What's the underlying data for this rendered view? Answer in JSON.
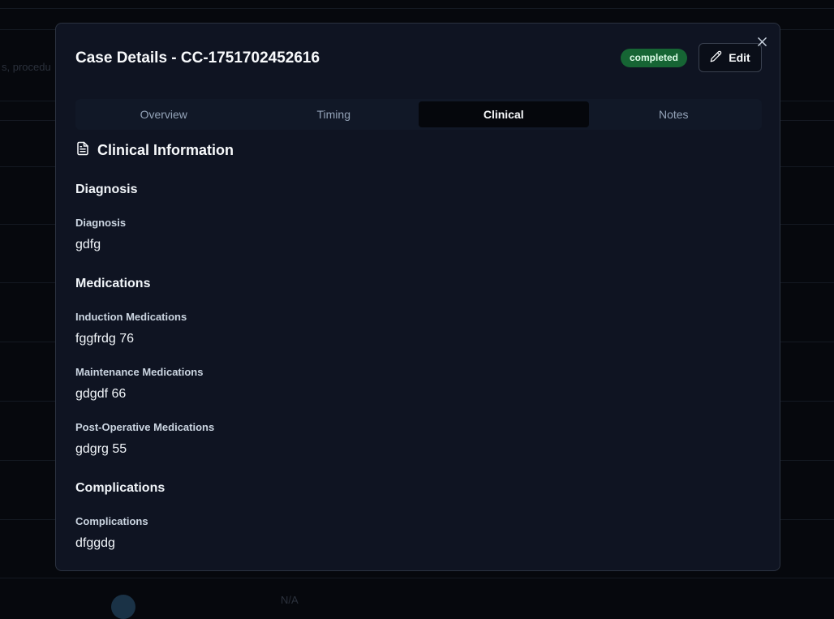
{
  "background": {
    "search_snippet": "s, procedu",
    "row_value": "N/A"
  },
  "modal": {
    "title": "Case Details - CC-1751702452616",
    "status": "completed",
    "edit_label": "Edit",
    "close_glyph": "×"
  },
  "tabs": [
    {
      "label": "Overview",
      "active": false
    },
    {
      "label": "Timing",
      "active": false
    },
    {
      "label": "Clinical",
      "active": true
    },
    {
      "label": "Notes",
      "active": false
    }
  ],
  "clinical": {
    "heading": "Clinical Information",
    "diagnosis": {
      "section": "Diagnosis",
      "label": "Diagnosis",
      "value": "gdfg"
    },
    "medications": {
      "section": "Medications",
      "induction_label": "Induction Medications",
      "induction_value": "fggfrdg 76",
      "maintenance_label": "Maintenance Medications",
      "maintenance_value": "gdgdf 66",
      "postop_label": "Post-Operative Medications",
      "postop_value": "gdgrg 55"
    },
    "complications": {
      "section": "Complications",
      "label": "Complications",
      "value": "dfggdg"
    }
  },
  "colors": {
    "badge": "#166534",
    "modal_bg": "#0f1422"
  },
  "icons": {
    "edit": "pencil-icon",
    "close": "close-icon",
    "section": "document-icon"
  }
}
